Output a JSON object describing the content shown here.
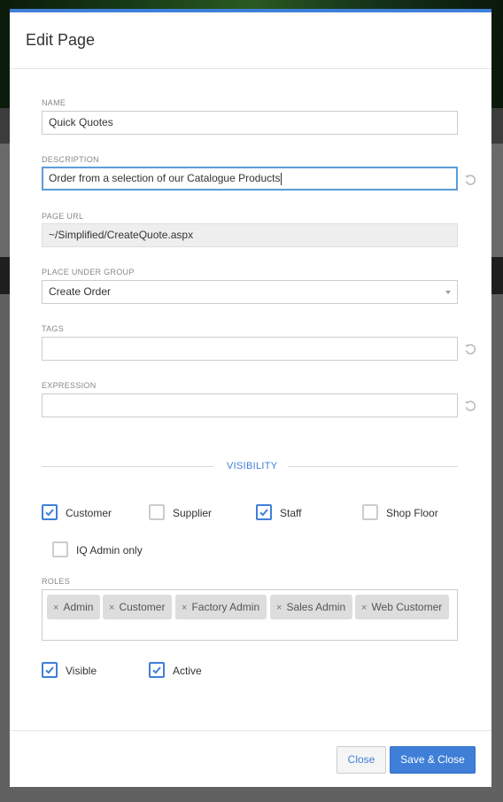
{
  "modal": {
    "title": "Edit Page"
  },
  "fields": {
    "name": {
      "label": "NAME",
      "value": "Quick Quotes"
    },
    "description": {
      "label": "DESCRIPTION",
      "value": "Order from a selection of our Catalogue Products"
    },
    "page_url": {
      "label": "PAGE URL",
      "value": "~/Simplified/CreateQuote.aspx"
    },
    "group": {
      "label": "PLACE UNDER GROUP",
      "value": "Create Order"
    },
    "tags": {
      "label": "TAGS",
      "value": ""
    },
    "expression": {
      "label": "EXPRESSION",
      "value": ""
    }
  },
  "visibility": {
    "title": "VISIBILITY",
    "options": [
      {
        "label": "Customer",
        "checked": true
      },
      {
        "label": "Supplier",
        "checked": false
      },
      {
        "label": "Staff",
        "checked": true
      },
      {
        "label": "Shop Floor",
        "checked": false
      },
      {
        "label": "IQ Admin only",
        "checked": false
      }
    ]
  },
  "roles": {
    "label": "ROLES",
    "remove_glyph": "×",
    "items": [
      "Admin",
      "Customer",
      "Factory Admin",
      "Sales Admin",
      "Web Customer"
    ]
  },
  "flags": [
    {
      "label": "Visible",
      "checked": true
    },
    {
      "label": "Active",
      "checked": true
    }
  ],
  "footer": {
    "close_label": "Close",
    "save_label": "Save & Close"
  },
  "colors": {
    "accent": "#3f7fd8",
    "focus_border": "#5b9dd9",
    "chip_bg": "#dddddd"
  },
  "icons": {
    "reset": "undo-reset-icon",
    "check": "checkmark-icon",
    "select": "chevron-down-icon"
  }
}
